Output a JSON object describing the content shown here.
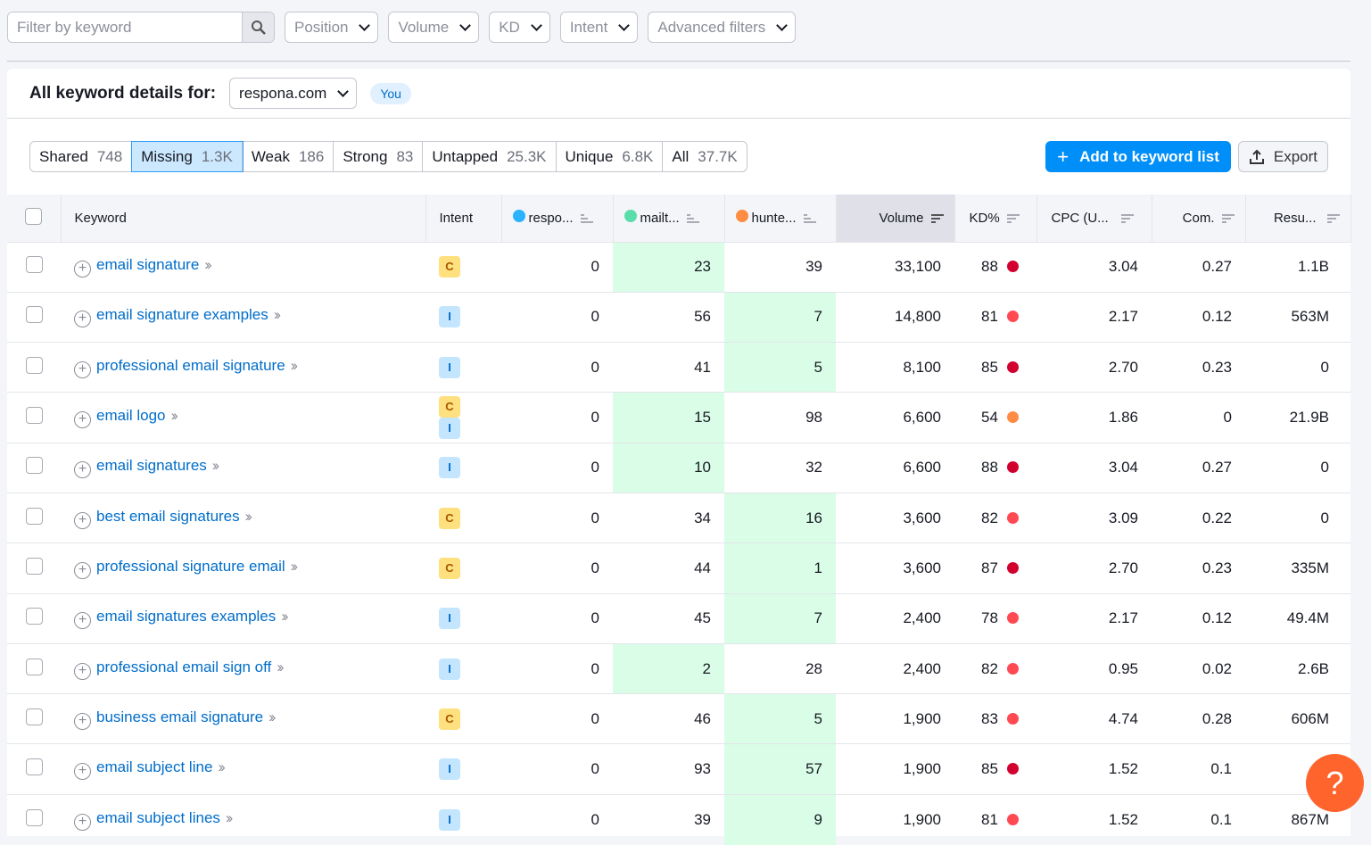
{
  "filters": {
    "search_placeholder": "Filter by keyword",
    "dropdowns": [
      "Position",
      "Volume",
      "KD",
      "Intent",
      "Advanced filters"
    ]
  },
  "header": {
    "title": "All keyword details for:",
    "domain": "respona.com",
    "badge": "You"
  },
  "tabs": [
    {
      "label": "Shared",
      "count": "748"
    },
    {
      "label": "Missing",
      "count": "1.3K",
      "active": true
    },
    {
      "label": "Weak",
      "count": "186"
    },
    {
      "label": "Strong",
      "count": "83"
    },
    {
      "label": "Untapped",
      "count": "25.3K"
    },
    {
      "label": "Unique",
      "count": "6.8K"
    },
    {
      "label": "All",
      "count": "37.7K"
    }
  ],
  "actions": {
    "add": "Add to keyword list",
    "export": "Export"
  },
  "columns": {
    "keyword": "Keyword",
    "intent": "Intent",
    "d1": "respo...",
    "d2": "mailt...",
    "d3": "hunte...",
    "volume": "Volume",
    "kd": "KD%",
    "cpc": "CPC (U...",
    "com": "Com.",
    "results": "Resu..."
  },
  "domain_colors": {
    "d1": "#2bb3ff",
    "d2": "#59ddaa",
    "d3": "#ff8c43"
  },
  "kd_colors": {
    "very_hard": "#d1002f",
    "hard": "#ff4953",
    "difficult": "#ff8c43"
  },
  "rows": [
    {
      "kw": "email signature",
      "intent": [
        "C"
      ],
      "d1": "0",
      "d2": "23",
      "d3": "39",
      "vol": "33,100",
      "kd": "88",
      "cpc": "3.04",
      "com": "0.27",
      "res": "1.1B"
    },
    {
      "kw": "email signature examples",
      "intent": [
        "I"
      ],
      "d1": "0",
      "d2": "56",
      "d3": "7",
      "vol": "14,800",
      "kd": "81",
      "cpc": "2.17",
      "com": "0.12",
      "res": "563M"
    },
    {
      "kw": "professional email signature",
      "intent": [
        "I"
      ],
      "d1": "0",
      "d2": "41",
      "d3": "5",
      "vol": "8,100",
      "kd": "85",
      "cpc": "2.70",
      "com": "0.23",
      "res": "0"
    },
    {
      "kw": "email logo",
      "intent": [
        "C",
        "I"
      ],
      "d1": "0",
      "d2": "15",
      "d3": "98",
      "vol": "6,600",
      "kd": "54",
      "cpc": "1.86",
      "com": "0",
      "res": "21.9B"
    },
    {
      "kw": "email signatures",
      "intent": [
        "I"
      ],
      "d1": "0",
      "d2": "10",
      "d3": "32",
      "vol": "6,600",
      "kd": "88",
      "cpc": "3.04",
      "com": "0.27",
      "res": "0"
    },
    {
      "kw": "best email signatures",
      "intent": [
        "C"
      ],
      "d1": "0",
      "d2": "34",
      "d3": "16",
      "vol": "3,600",
      "kd": "82",
      "cpc": "3.09",
      "com": "0.22",
      "res": "0"
    },
    {
      "kw": "professional signature email",
      "intent": [
        "C"
      ],
      "d1": "0",
      "d2": "44",
      "d3": "1",
      "vol": "3,600",
      "kd": "87",
      "cpc": "2.70",
      "com": "0.23",
      "res": "335M"
    },
    {
      "kw": "email signatures examples",
      "intent": [
        "I"
      ],
      "d1": "0",
      "d2": "45",
      "d3": "7",
      "vol": "2,400",
      "kd": "78",
      "cpc": "2.17",
      "com": "0.12",
      "res": "49.4M"
    },
    {
      "kw": "professional email sign off",
      "intent": [
        "I"
      ],
      "d1": "0",
      "d2": "2",
      "d3": "28",
      "vol": "2,400",
      "kd": "82",
      "cpc": "0.95",
      "com": "0.02",
      "res": "2.6B"
    },
    {
      "kw": "business email signature",
      "intent": [
        "C"
      ],
      "d1": "0",
      "d2": "46",
      "d3": "5",
      "vol": "1,900",
      "kd": "83",
      "cpc": "4.74",
      "com": "0.28",
      "res": "606M"
    },
    {
      "kw": "email subject line",
      "intent": [
        "I"
      ],
      "d1": "0",
      "d2": "93",
      "d3": "57",
      "vol": "1,900",
      "kd": "85",
      "cpc": "1.52",
      "com": "0.1",
      "res": ""
    },
    {
      "kw": "email subject lines",
      "intent": [
        "I"
      ],
      "d1": "0",
      "d2": "39",
      "d3": "9",
      "vol": "1,900",
      "kd": "81",
      "cpc": "1.52",
      "com": "0.1",
      "res": "867M"
    }
  ],
  "help": "?"
}
